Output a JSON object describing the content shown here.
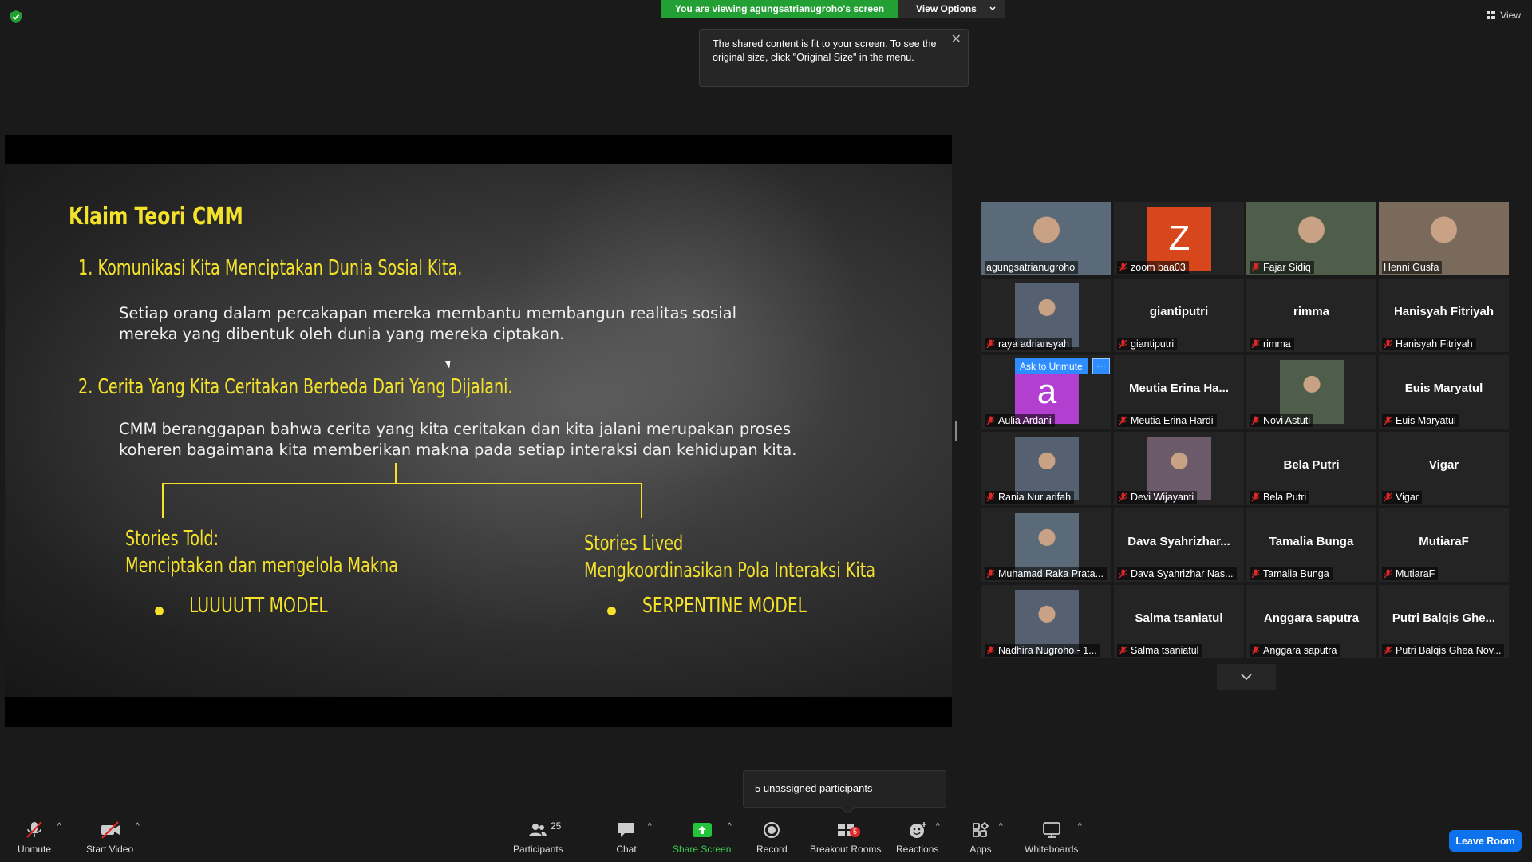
{
  "topbar": {
    "viewing_text": "You are viewing agungsatrianugroho's screen",
    "view_options": "View Options",
    "view_label": "View"
  },
  "tooltip": {
    "text": "The shared content is fit to your screen. To see the original size, click \"Original Size\" in the menu."
  },
  "slide": {
    "title": "Klaim Teori CMM",
    "point1": "1.  Komunikasi Kita Menciptakan Dunia Sosial Kita.",
    "body1": "Setiap orang dalam percakapan mereka membantu membangun realitas sosial mereka yang dibentuk oleh dunia yang mereka ciptakan.",
    "point2": "2.  Cerita Yang Kita Ceritakan Berbeda Dari Yang Dijalani.",
    "body2": "CMM beranggapan bahwa cerita yang kita ceritakan dan kita jalani merupakan proses koheren bagaimana kita memberikan makna pada setiap interaksi dan kehidupan kita.",
    "left_heading": "Stories Told:",
    "left_sub": "Menciptakan dan mengelola Makna",
    "left_bullet": "LUUUUTT MODEL",
    "right_heading": "Stories Lived",
    "right_sub": "Mengkoordinasikan Pola Interaksi Kita",
    "right_bullet": "SERPENTINE MODEL"
  },
  "gallery": {
    "tiles": [
      {
        "name": "agungsatrianugroho",
        "display": "",
        "kind": "photo",
        "active": true,
        "muted": false
      },
      {
        "name": "zoom baa03",
        "display": "",
        "kind": "letter",
        "letter": "Z",
        "color": "#d8461c",
        "muted": true
      },
      {
        "name": "Fajar Sidiq",
        "display": "",
        "kind": "photo",
        "muted": true
      },
      {
        "name": "Henni Gusfa",
        "display": "",
        "kind": "photo",
        "muted": false
      },
      {
        "name": "raya adriansyah",
        "display": "",
        "kind": "photo",
        "muted": true
      },
      {
        "name": "giantiputri",
        "display": "giantiputri",
        "kind": "name",
        "muted": true
      },
      {
        "name": "rimma",
        "display": "rimma",
        "kind": "name",
        "muted": true
      },
      {
        "name": "Hanisyah Fitriyah",
        "display": "Hanisyah Fitriyah",
        "kind": "name",
        "muted": true
      },
      {
        "name": "Aulia Ardani",
        "display": "",
        "kind": "letter",
        "letter": "a",
        "color": "#b23fcf",
        "muted": true,
        "ask": "Ask to Unmute",
        "more": "···"
      },
      {
        "name": "Meutia Erina Hardi",
        "display": "Meutia  Erina  Ha...",
        "kind": "name",
        "muted": true
      },
      {
        "name": "Novi Astuti",
        "display": "",
        "kind": "photo",
        "muted": true
      },
      {
        "name": "Euis Maryatul",
        "display": "Euis Maryatul",
        "kind": "name",
        "muted": true
      },
      {
        "name": "Rania Nur arifah",
        "display": "",
        "kind": "photo",
        "muted": true
      },
      {
        "name": "Devi Wijayanti",
        "display": "",
        "kind": "photo",
        "muted": true
      },
      {
        "name": "Bela Putri",
        "display": "Bela Putri",
        "kind": "name",
        "muted": true
      },
      {
        "name": "Vigar",
        "display": "Vigar",
        "kind": "name",
        "muted": true
      },
      {
        "name": "Muhamad Raka Prata...",
        "display": "",
        "kind": "photo",
        "muted": true
      },
      {
        "name": "Dava Syahrizhar Nas...",
        "display": "Dava  Syahrizhar...",
        "kind": "name",
        "muted": true
      },
      {
        "name": "Tamalia Bunga",
        "display": "Tamalia Bunga",
        "kind": "name",
        "muted": true
      },
      {
        "name": "MutiaraF",
        "display": "MutiaraF",
        "kind": "name",
        "muted": true
      },
      {
        "name": "Nadhira Nugroho - 1...",
        "display": "",
        "kind": "photo",
        "muted": true
      },
      {
        "name": "Salma tsaniatul",
        "display": "Salma tsaniatul",
        "kind": "name",
        "muted": true
      },
      {
        "name": "Anggara saputra",
        "display": "Anggara saputra",
        "kind": "name",
        "muted": true
      },
      {
        "name": "Putri Balqis Ghea Nov...",
        "display": "Putri  Balqis  Ghe...",
        "kind": "name",
        "muted": true
      }
    ]
  },
  "popover": {
    "unassigned": "5 unassigned participants"
  },
  "toolbar": {
    "unmute": "Unmute",
    "start_video": "Start Video",
    "participants": "Participants",
    "participants_count": "25",
    "chat": "Chat",
    "share_screen": "Share Screen",
    "record": "Record",
    "breakout_rooms": "Breakout Rooms",
    "breakout_badge": "5",
    "reactions": "Reactions",
    "apps": "Apps",
    "whiteboards": "Whiteboards",
    "leave": "Leave Room"
  },
  "colors": {
    "accent_green": "#23a033",
    "slide_yellow": "#f4e22a",
    "leave_blue": "#0e72ed",
    "active_outline": "#e3e35a"
  }
}
